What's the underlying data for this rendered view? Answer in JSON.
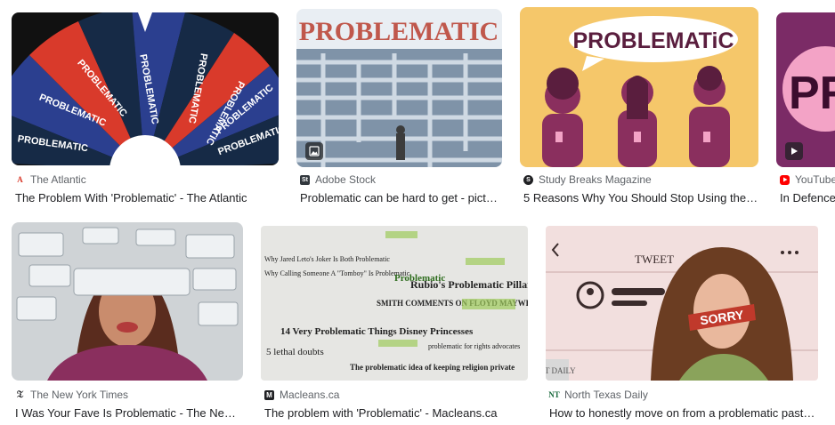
{
  "results": [
    {
      "source": "The Atlantic",
      "title": "The Problem With 'Problematic' - The Atlantic",
      "image_text": "PROBLEMATIC"
    },
    {
      "source": "Adobe Stock",
      "title": "Problematic can be hard to get - picture...",
      "image_text": "PROBLEMATIC"
    },
    {
      "source": "Study Breaks Magazine",
      "title": "5 Reasons Why You Should Stop Using the W...",
      "image_text": "PROBLEMATiC"
    },
    {
      "source": "YouTube",
      "title": "In Defence",
      "image_text": "PR"
    },
    {
      "source": "The New York Times",
      "title": "I Was Your Fave Is Problematic - The New Y..."
    },
    {
      "source": "Macleans.ca",
      "title": "The problem with 'Problematic' - Macleans.ca",
      "collage": [
        "Why Jared Leto's Joker Is Both Problematic",
        "Why Calling Someone A \"Tomboy\" Is Problematic",
        "Problematic",
        "Rubio's Problematic Pillar",
        "SMITH COMMENTS ON FLOYD MAYWEATHER AND DOMESTIC",
        "14 Very Problematic Things Disney Princesses",
        "The problematic idea of keeping religion private",
        "5 lethal doubts",
        "problematic for rights advocates"
      ]
    },
    {
      "source": "North Texas Daily",
      "title": "How to honestly move on from a problematic past –...",
      "image_text_1": "TWEET",
      "image_text_2": "SORRY",
      "logo": "NT DAILY"
    }
  ],
  "colors": {
    "red": "#d93a2b",
    "blue": "#2b3f8f",
    "navy": "#162a46",
    "plum": "#8a2f5e",
    "yellow": "#f5c76a"
  }
}
